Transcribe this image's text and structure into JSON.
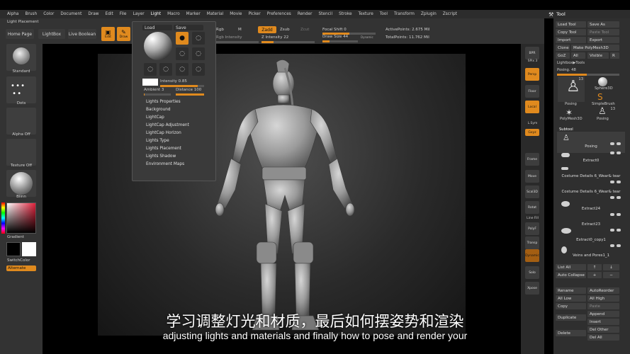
{
  "menubar": {
    "items": [
      "Alpha",
      "Brush",
      "Color",
      "Document",
      "Draw",
      "Edit",
      "File",
      "Layer",
      "Light",
      "Macro",
      "Marker",
      "Material",
      "Movie",
      "Picker",
      "Preferences",
      "Render",
      "Stencil",
      "Stroke",
      "Texture",
      "Tool",
      "Transform",
      "Zplugin",
      "Zscript"
    ],
    "active": "Light"
  },
  "tool_header": {
    "title": "Tool"
  },
  "top_left": {
    "section_title": "Light Placement",
    "home_page": "Home Page",
    "lightbox": "LightBox",
    "live_boolean": "Live Boolean",
    "edit": "Edit",
    "draw": "Draw"
  },
  "toolbar": {
    "rgb": "Rgb",
    "m": "M",
    "zadd": "Zadd",
    "zsub": "Zsub",
    "zcut": "Zcut",
    "rgb_intensity_label": "Rgb Intensity",
    "z_intensity_label": "Z Intensity 22",
    "focal_shift": "Focal Shift 0",
    "draw_size": "Draw Size 44",
    "dynamic": "Dynamic",
    "active_points": "ActivePoints: 2.675 Mil",
    "total_points": "TotalPoints: 11.762 Mil"
  },
  "left_panel": {
    "standard": "Standard",
    "dots": "Dots",
    "alpha_off": "Alpha Off",
    "texture_off": "Texture Off",
    "blinn": "Blinn",
    "gradient": "Gradient",
    "switch_color": "SwitchColor",
    "alternate": "Alternate"
  },
  "light_menu": {
    "load": "Load",
    "save": "Save",
    "intensity": "Intensity 0.85",
    "intensity_value": 0.85,
    "ambient": "Ambient 3",
    "distance": "Distance 100",
    "items": [
      "Lights Properties",
      "Background",
      "LightCap",
      "LightCap Adjustment",
      "LightCap Horizon",
      "Lights Type",
      "Lights Placement",
      "Lights Shadow",
      "Environment Maps"
    ]
  },
  "right_toolbar": {
    "bpr": "BPR",
    "spix": "SPix 3",
    "persp": "Persp",
    "floor": "Floor",
    "local": "Local",
    "lsym": "L.Sym",
    "xyz": "Gxyz",
    "frame": "Frame",
    "move": "Move",
    "scale3d": "Scal3D",
    "rotate": "Rotat",
    "line_fill": "Line Fill",
    "polyf": "PolyF",
    "transp": "Transp",
    "dynamic": "Dynamic",
    "solo": "Solo",
    "xpose": "Xpose"
  },
  "tool_panel": {
    "load_tool": "Load Tool",
    "save_as": "Save As",
    "copy_tool": "Copy Tool",
    "paste_tool": "Paste Tool",
    "import": "Import",
    "export": "Export",
    "clone": "Clone",
    "make_polymesh": "Make PolyMesh3D",
    "goz": "GoZ",
    "all": "All",
    "visible": "Visible",
    "r": "R",
    "lightbox_tools": "Lightbox▶Tools",
    "posing": "Posing. 48",
    "posing_value": 48,
    "thumbs": [
      {
        "name": "Posing",
        "count": "13"
      },
      {
        "name": "Sphere3D",
        "count": ""
      },
      {
        "name": "Posing",
        "count": ""
      },
      {
        "name": "SimpleBrush",
        "count": ""
      },
      {
        "name": "PolyMesh3D",
        "count": ""
      },
      {
        "name": "Posing",
        "count": "13"
      }
    ],
    "subtool_title": "Subtool",
    "subtools": [
      "Posing",
      "Extract0",
      "Costume Details 6_Wear& tear",
      "Costume Details 6_Wear& tear",
      "Extract24",
      "Extract23",
      "Extract0_copy1",
      "Veins and Pores1_1"
    ],
    "list_all": "List All",
    "auto_collapse": "Auto Collapse",
    "rename": "Rename",
    "auto_reorder": "AutoReorder",
    "all_low": "All Low",
    "all_high": "All High",
    "copy": "Copy",
    "paste": "Paste",
    "append": "Append",
    "duplicate": "Duplicate",
    "insert": "Insert",
    "delete": "Delete",
    "del_other": "Del Other",
    "del_all": "Del All"
  },
  "subtitles": {
    "cn": "学习调整灯光和材质，最后如何摆姿势和渲染",
    "en": "adjusting lights and materials and finally how to pose and render your"
  }
}
